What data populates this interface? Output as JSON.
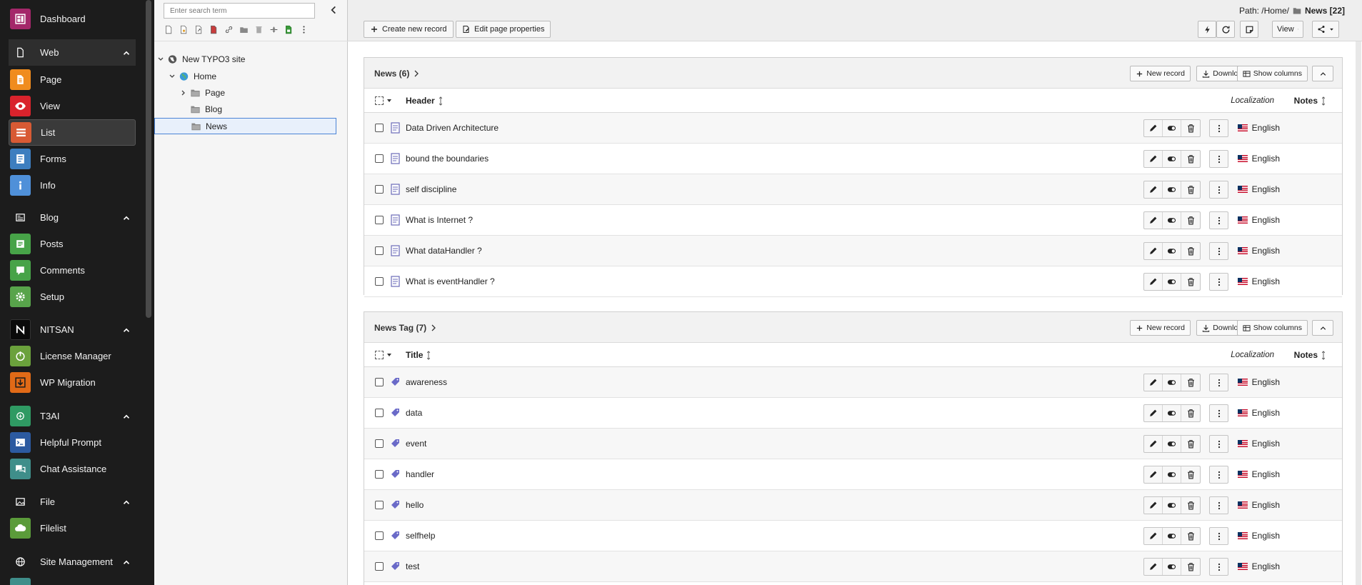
{
  "modules": {
    "dashboard": "Dashboard",
    "web": "Web",
    "page": "Page",
    "view": "View",
    "list": "List",
    "forms": "Forms",
    "info": "Info",
    "blog": "Blog",
    "posts": "Posts",
    "comments": "Comments",
    "setup": "Setup",
    "nitsan": "NITSAN",
    "license_manager": "License Manager",
    "wp_migration": "WP Migration",
    "t3ai": "T3AI",
    "helpful_prompt": "Helpful Prompt",
    "chat_assistance": "Chat Assistance",
    "file": "File",
    "filelist": "Filelist",
    "site_management": "Site Management"
  },
  "tree": {
    "search_placeholder": "Enter search term",
    "root": "New TYPO3 site",
    "home": "Home",
    "page": "Page",
    "blog": "Blog",
    "news": "News"
  },
  "header": {
    "path_label": "Path: /Home/",
    "path_page": "News [22]",
    "create_record": "Create new record",
    "edit_page": "Edit page properties",
    "view": "View"
  },
  "panels": {
    "news": {
      "title": "News (6)",
      "column": "Header",
      "rows": [
        "Data Driven Architecture",
        "bound the boundaries",
        "self discipline",
        "What is Internet ?",
        "What dataHandler ?",
        "What is eventHandler ?"
      ]
    },
    "tags": {
      "title": "News Tag (7)",
      "column": "Title",
      "rows": [
        "awareness",
        "data",
        "event",
        "handler",
        "hello",
        "selfhelp",
        "test"
      ]
    },
    "new_record": "New record",
    "download": "Download",
    "show_columns": "Show columns",
    "localization": "Localization",
    "notes": "Notes",
    "language": "English"
  },
  "colors": {
    "menu_bg": "#1c1c1c",
    "dashboard": "#a4276a",
    "page": "#f08c1e",
    "view": "#d9232c",
    "list": "#d85a34",
    "forms": "#3d7ebf",
    "info": "#4f90d9",
    "posts": "#47a348",
    "setup": "#58a44b",
    "nitsan": "#0a0a0a",
    "license": "#6ba13c",
    "wp": "#e16a17",
    "t3ai": "#2f9a63",
    "helpful": "#2c5aa0",
    "chat": "#3f8e8a",
    "filelist": "#5b9b3a",
    "selection": "#4b84d6"
  }
}
